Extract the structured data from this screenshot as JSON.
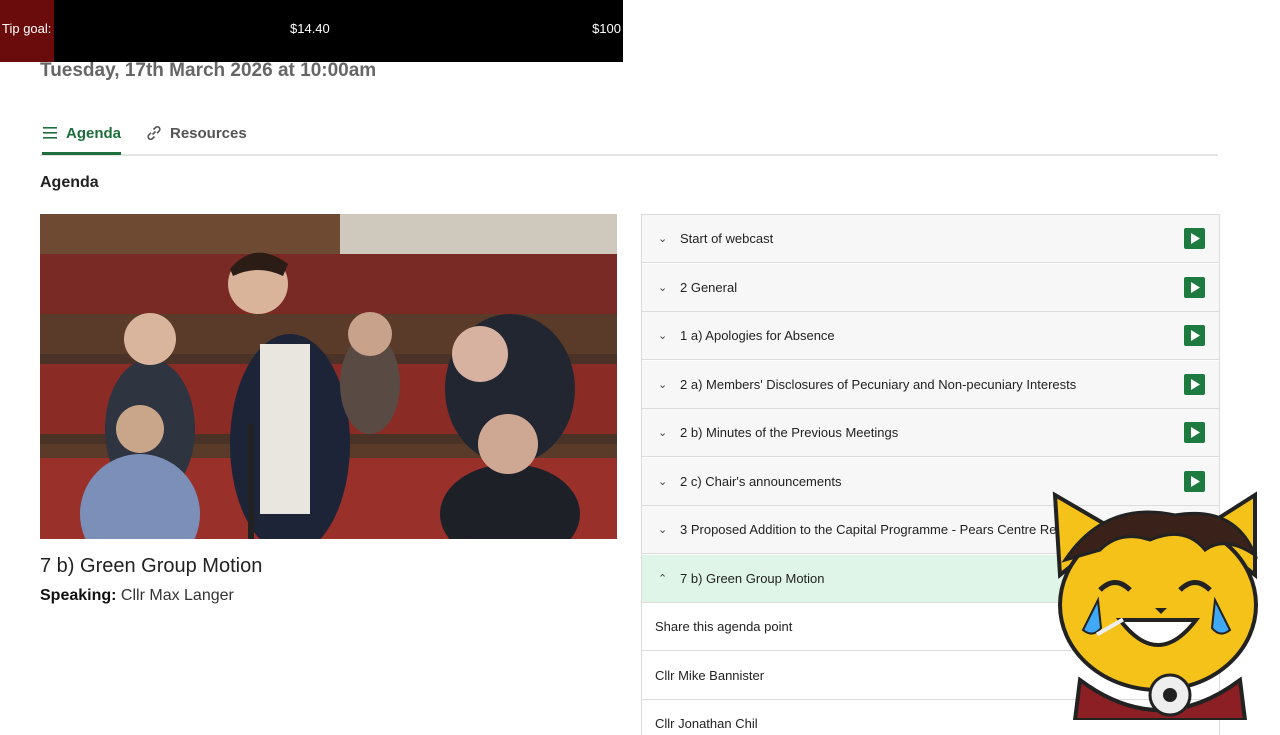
{
  "tip": {
    "label": "Tip goal:",
    "current": "$14.40",
    "goal": "$100",
    "progress": 0.144
  },
  "meeting": {
    "date": "Tuesday, 17th March 2026 at 10:00am"
  },
  "tabs": [
    {
      "label": "Agenda",
      "icon": "menu-icon",
      "active": true
    },
    {
      "label": "Resources",
      "icon": "link-icon",
      "active": false
    }
  ],
  "section_heading": "Agenda",
  "now_playing": {
    "title": "7 b) Green Group Motion",
    "speaking_label": "Speaking:",
    "speaker": "Cllr Max Langer"
  },
  "agenda": [
    {
      "label": "Start of webcast",
      "state": "collapsed"
    },
    {
      "label": "2 General",
      "state": "collapsed"
    },
    {
      "label": "1 a) Apologies for Absence",
      "state": "collapsed"
    },
    {
      "label": "2 a) Members' Disclosures of Pecuniary and Non-pecuniary Interests",
      "state": "collapsed"
    },
    {
      "label": "2 b) Minutes of the Previous Meetings",
      "state": "collapsed"
    },
    {
      "label": "2 c) Chair's announcements",
      "state": "collapsed"
    },
    {
      "label": "3 Proposed Addition to the Capital Programme - Pears Centre Re",
      "state": "collapsed"
    },
    {
      "label": "7 b) Green Group Motion",
      "state": "expanded"
    }
  ],
  "sub_items": [
    {
      "label": "Share this agenda point"
    },
    {
      "label": "Cllr Mike Bannister"
    },
    {
      "label": "Cllr Jonathan Chil"
    }
  ],
  "colors": {
    "accent": "#1e6e3c",
    "play": "#1e7b40",
    "active_row": "#dff5e7",
    "tip_progress": "#6b0c0c"
  }
}
